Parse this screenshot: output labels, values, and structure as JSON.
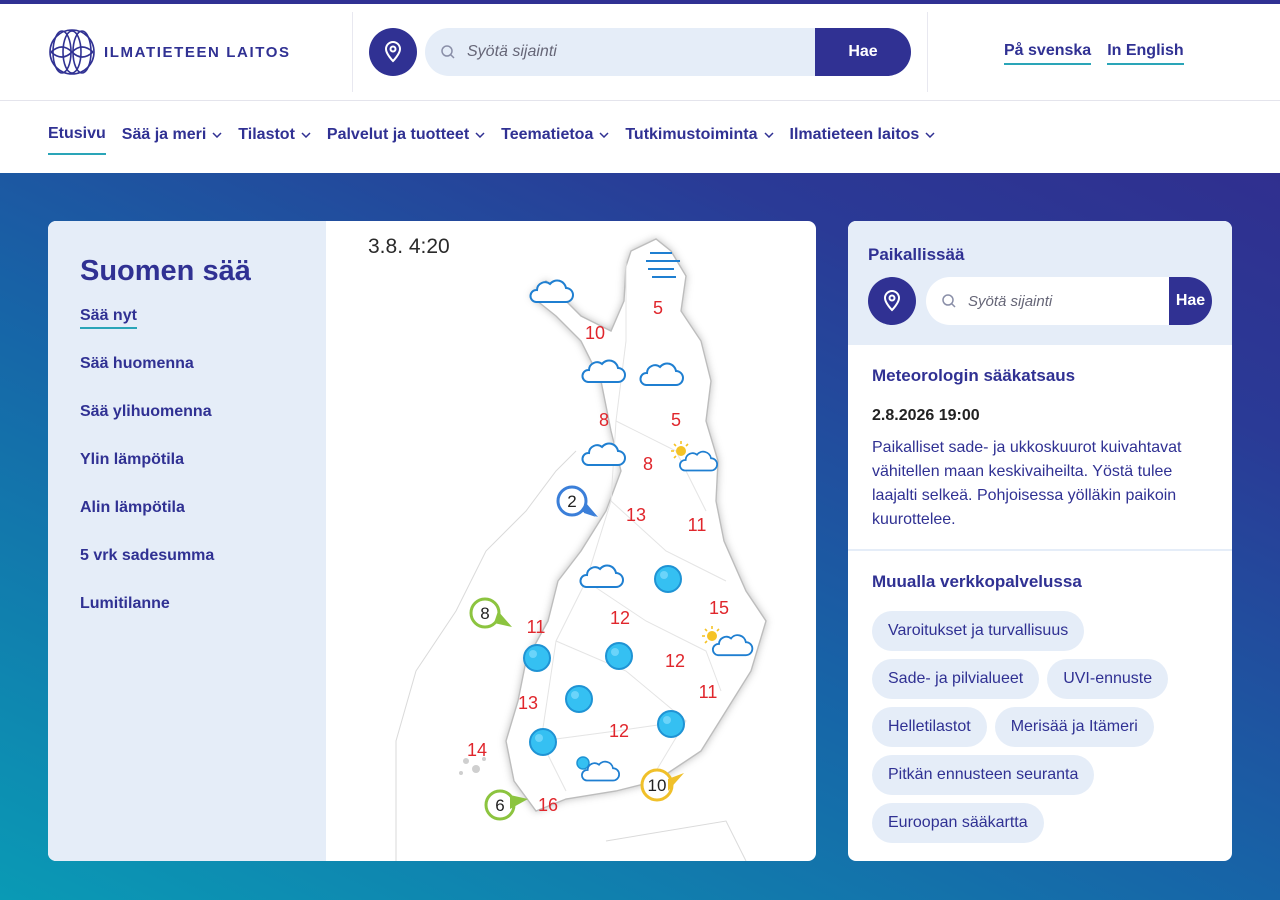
{
  "brand": {
    "name": "ILMATIETEEN LAITOS"
  },
  "header": {
    "search_placeholder": "Syötä sijainti",
    "search_button": "Hae",
    "languages": [
      "På svenska",
      "In English"
    ]
  },
  "nav": {
    "items": [
      {
        "label": "Etusivu",
        "dropdown": false
      },
      {
        "label": "Sää ja meri",
        "dropdown": true
      },
      {
        "label": "Tilastot",
        "dropdown": true
      },
      {
        "label": "Palvelut ja tuotteet",
        "dropdown": true
      },
      {
        "label": "Teematietoa",
        "dropdown": true
      },
      {
        "label": "Tutkimustoiminta",
        "dropdown": true
      },
      {
        "label": "Ilmatieteen laitos",
        "dropdown": true
      }
    ]
  },
  "weather_panel": {
    "title": "Suomen sää",
    "menu": [
      "Sää nyt",
      "Sää huomenna",
      "Sää ylihuomenna",
      "Ylin lämpötila",
      "Alin lämpötila",
      "5 vrk sadesumma",
      "Lumitilanne"
    ],
    "map": {
      "timestamp": "3.8. 4:20",
      "temperatures": [
        "5",
        "10",
        "8",
        "5",
        "8",
        "13",
        "11",
        "12",
        "15",
        "11",
        "12",
        "13",
        "11",
        "12",
        "14",
        "16"
      ],
      "wind_markers": [
        "2",
        "8",
        "6",
        "10"
      ]
    }
  },
  "local_panel": {
    "title": "Paikallissää",
    "search_placeholder": "Syötä sijainti",
    "search_button": "Hae"
  },
  "forecast": {
    "title": "Meteorologin sääkatsaus",
    "date": "2.8.2026 19:00",
    "text": "Paikalliset sade- ja ukkoskuurot kuivahtavat vähitellen maan keskivaiheilta. Yöstä tulee laajalti selkeä. Pohjoisessa yölläkin paikoin kuurottelee."
  },
  "elsewhere": {
    "title": "Muualla verkkopalvelussa",
    "links": [
      "Varoitukset ja turvallisuus",
      "Sade- ja pilvialueet",
      "UVI-ennuste",
      "Helletilastot",
      "Merisää ja Itämeri",
      "Pitkän ennusteen seuranta",
      "Euroopan sääkartta"
    ]
  },
  "colors": {
    "primary": "#303193",
    "accent": "#2aa5b8",
    "light_bg": "#e5edf8",
    "temp_red": "#e0262c"
  }
}
